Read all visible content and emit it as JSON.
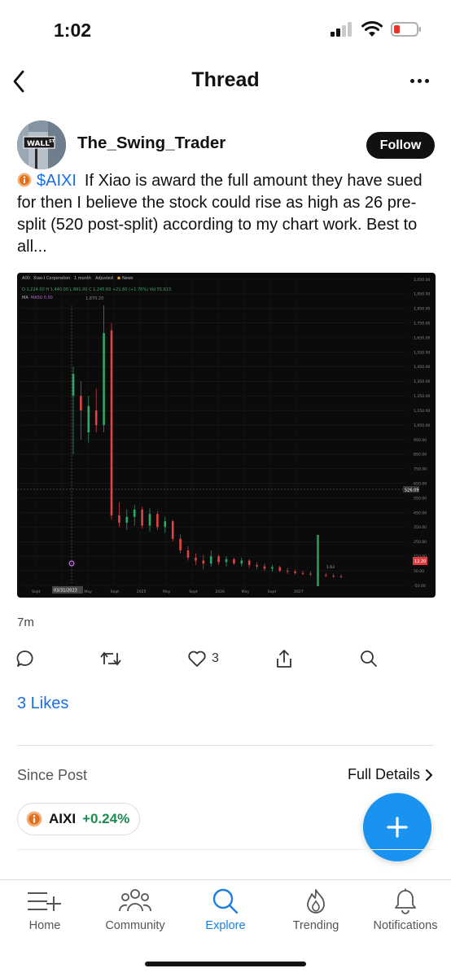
{
  "status_bar": {
    "time": "1:02"
  },
  "nav": {
    "title": "Thread"
  },
  "post": {
    "username": "The_Swing_Trader",
    "avatar_sign": "WALL",
    "avatar_sign_sup": "ST",
    "follow_label": "Follow",
    "ticker": "$AIXI",
    "body": "If Xiao is award the full amount they have sued for then I believe the stock could rise as high as 26 pre-split (520 post-split) according to my chart work.  Best to all...",
    "timestamp": "7m",
    "like_count": "3",
    "likes_label": "3 Likes"
  },
  "chart_data": {
    "type": "candlestick",
    "header": {
      "symbol": "AIXI",
      "name": "Xiao-I Corporation",
      "period": "1 month",
      "adjusted": "Adjusted",
      "news": "News",
      "ohlc": "O 1,224.00  H 1,440.00  L 891.00  C 1,245.60  +21.60 (+1.76%)  Vol 55,613",
      "ma": "MA",
      "ma_value": "MA50 0.00",
      "peak_label": "1,870.20"
    },
    "y_ticks": [
      "2,050.00",
      "1,950.00",
      "1,850.00",
      "1,750.00",
      "1,650.00",
      "1,550.00",
      "1,450.00",
      "1,350.00",
      "1,250.00",
      "1,150.00",
      "1,050.00",
      "950.00",
      "850.00",
      "750.00",
      "650.00",
      "550.00",
      "450.00",
      "350.00",
      "250.00",
      "150.00",
      "50.00",
      "-50.00"
    ],
    "x_ticks": [
      "Sept",
      "2024",
      "May",
      "Sept",
      "2025",
      "May",
      "Sept",
      "2026",
      "May",
      "Sept",
      "2027"
    ],
    "date_marker": "03/31/2023",
    "price_marker": "526.09",
    "last_price": "12.20",
    "low_label": "1.63",
    "ylim": [
      -50,
      2050
    ],
    "candles": [
      {
        "o": 1400,
        "h": 1450,
        "l": 850,
        "c": 1250,
        "up": true
      },
      {
        "o": 1250,
        "h": 1350,
        "l": 950,
        "c": 1150,
        "up": false
      },
      {
        "o": 1000,
        "h": 1250,
        "l": 930,
        "c": 1180,
        "up": true
      },
      {
        "o": 1150,
        "h": 1300,
        "l": 1000,
        "c": 1050,
        "up": false
      },
      {
        "o": 1050,
        "h": 1870,
        "l": 1000,
        "c": 1680,
        "up": true
      },
      {
        "o": 1700,
        "h": 1750,
        "l": 400,
        "c": 430,
        "up": false
      },
      {
        "o": 430,
        "h": 520,
        "l": 350,
        "c": 380,
        "up": false
      },
      {
        "o": 380,
        "h": 470,
        "l": 330,
        "c": 420,
        "up": true
      },
      {
        "o": 420,
        "h": 500,
        "l": 360,
        "c": 470,
        "up": true
      },
      {
        "o": 470,
        "h": 490,
        "l": 340,
        "c": 360,
        "up": false
      },
      {
        "o": 360,
        "h": 480,
        "l": 320,
        "c": 440,
        "up": true
      },
      {
        "o": 440,
        "h": 460,
        "l": 330,
        "c": 350,
        "up": false
      },
      {
        "o": 350,
        "h": 420,
        "l": 310,
        "c": 390,
        "up": true
      },
      {
        "o": 390,
        "h": 400,
        "l": 250,
        "c": 270,
        "up": false
      },
      {
        "o": 270,
        "h": 300,
        "l": 170,
        "c": 190,
        "up": false
      },
      {
        "o": 190,
        "h": 220,
        "l": 120,
        "c": 140,
        "up": false
      },
      {
        "o": 140,
        "h": 170,
        "l": 90,
        "c": 120,
        "up": false
      },
      {
        "o": 120,
        "h": 160,
        "l": 60,
        "c": 100,
        "up": false
      },
      {
        "o": 100,
        "h": 190,
        "l": 80,
        "c": 150,
        "up": true
      },
      {
        "o": 150,
        "h": 160,
        "l": 90,
        "c": 110,
        "up": false
      },
      {
        "o": 110,
        "h": 150,
        "l": 80,
        "c": 130,
        "up": true
      },
      {
        "o": 130,
        "h": 140,
        "l": 90,
        "c": 100,
        "up": false
      },
      {
        "o": 100,
        "h": 140,
        "l": 80,
        "c": 120,
        "up": true
      },
      {
        "o": 120,
        "h": 130,
        "l": 70,
        "c": 90,
        "up": false
      },
      {
        "o": 90,
        "h": 110,
        "l": 60,
        "c": 80,
        "up": false
      },
      {
        "o": 80,
        "h": 100,
        "l": 50,
        "c": 65,
        "up": false
      },
      {
        "o": 65,
        "h": 90,
        "l": 45,
        "c": 75,
        "up": true
      },
      {
        "o": 75,
        "h": 85,
        "l": 40,
        "c": 50,
        "up": false
      },
      {
        "o": 50,
        "h": 70,
        "l": 30,
        "c": 45,
        "up": false
      },
      {
        "o": 45,
        "h": 60,
        "l": 25,
        "c": 35,
        "up": false
      },
      {
        "o": 35,
        "h": 50,
        "l": 20,
        "c": 30,
        "up": false
      },
      {
        "o": 30,
        "h": 45,
        "l": 15,
        "c": 25,
        "up": false
      },
      {
        "o": 25,
        "h": 40,
        "l": 10,
        "c": 20,
        "up": false
      },
      {
        "o": 20,
        "h": 35,
        "l": 8,
        "c": 15,
        "up": false
      },
      {
        "o": 15,
        "h": 30,
        "l": 5,
        "c": 12,
        "up": false
      },
      {
        "o": 12,
        "h": 25,
        "l": 2,
        "c": 10,
        "up": false
      }
    ]
  },
  "since_post": {
    "label": "Since Post",
    "details_label": "Full Details"
  },
  "chip": {
    "symbol": "AIXI",
    "change": "+0.24%"
  },
  "tabs": [
    {
      "label": "Home"
    },
    {
      "label": "Community"
    },
    {
      "label": "Explore"
    },
    {
      "label": "Trending"
    },
    {
      "label": "Notifications"
    }
  ]
}
